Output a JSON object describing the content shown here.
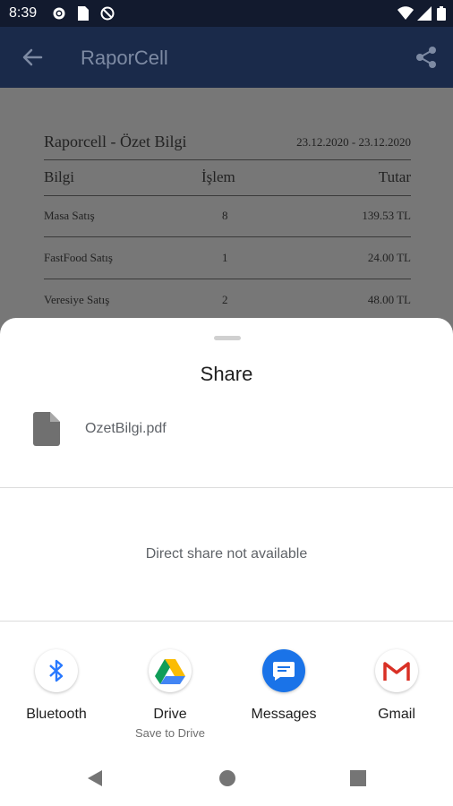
{
  "status_bar": {
    "time": "8:39",
    "icons": [
      "settings-icon",
      "sim-card-icon",
      "do-not-disturb-icon",
      "wifi-icon",
      "signal-icon",
      "battery-icon"
    ]
  },
  "app_bar": {
    "title": "RaporCell",
    "back_icon": "arrow-back-icon",
    "share_icon": "share-icon"
  },
  "report": {
    "title": "Raporcell - Özet Bilgi",
    "date_range": "23.12.2020 - 23.12.2020",
    "columns": [
      "Bilgi",
      "İşlem",
      "Tutar"
    ],
    "rows": [
      {
        "label": "Masa Satış",
        "count": "8",
        "amount": "139.53 TL"
      },
      {
        "label": "FastFood Satış",
        "count": "1",
        "amount": "24.00 TL"
      },
      {
        "label": "Veresiye Satış",
        "count": "2",
        "amount": "48.00 TL"
      }
    ]
  },
  "share_sheet": {
    "title": "Share",
    "file_name": "OzetBilgi.pdf",
    "direct_share_message": "Direct share not available",
    "targets": [
      {
        "label": "Bluetooth",
        "sublabel": "",
        "icon": "bluetooth-icon"
      },
      {
        "label": "Drive",
        "sublabel": "Save to Drive",
        "icon": "google-drive-icon"
      },
      {
        "label": "Messages",
        "sublabel": "",
        "icon": "messages-icon"
      },
      {
        "label": "Gmail",
        "sublabel": "",
        "icon": "gmail-icon"
      }
    ]
  },
  "nav_bar": {
    "buttons": [
      "back-nav-icon",
      "home-nav-icon",
      "recents-nav-icon"
    ]
  },
  "colors": {
    "status_bar": "#121a2e",
    "app_bar": "#1a2a4a",
    "scrim_content": "#777777",
    "sheet": "#ffffff",
    "messages_blue": "#1a73e8",
    "bluetooth_blue": "#2979ff",
    "gmail_red": "#d93025"
  }
}
